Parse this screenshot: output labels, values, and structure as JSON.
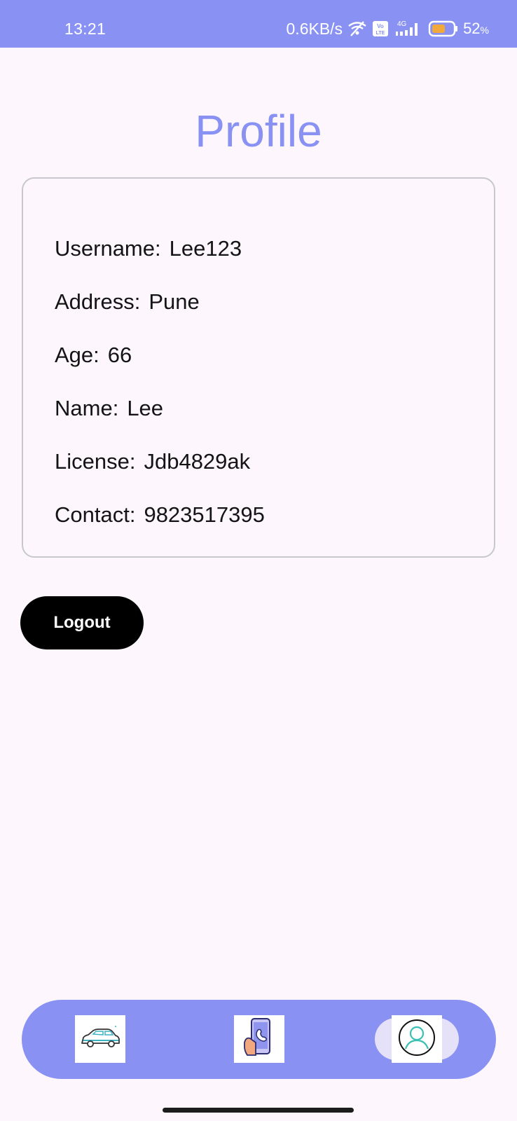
{
  "status_bar": {
    "time": "13:21",
    "network_speed": "0.6KB/s",
    "volte_label": "Vo\nLTE",
    "network_type": "4G",
    "battery_percent": "52",
    "battery_unit": "%",
    "icons": [
      "wifi-off-icon",
      "volte-icon",
      "signal-icon",
      "battery-icon"
    ],
    "color": "#8992f3"
  },
  "page": {
    "title": "Profile",
    "title_color": "#8992f3",
    "background": "#fdf7fd"
  },
  "profile": {
    "fields": [
      {
        "label": "Username:",
        "value": "Lee123"
      },
      {
        "label": "Address:",
        "value": "Pune"
      },
      {
        "label": "Age:",
        "value": "66"
      },
      {
        "label": "Name:",
        "value": "Lee"
      },
      {
        "label": "License:",
        "value": "Jdb4829ak"
      },
      {
        "label": "Contact:",
        "value": "9823517395"
      }
    ]
  },
  "actions": {
    "logout_label": "Logout"
  },
  "bottom_nav": {
    "items": [
      {
        "icon": "car-icon",
        "active": false
      },
      {
        "icon": "phone-call-icon",
        "active": false
      },
      {
        "icon": "user-profile-icon",
        "active": true
      }
    ],
    "color": "#8992f3",
    "active_pill_color": "#e5e1f8"
  }
}
